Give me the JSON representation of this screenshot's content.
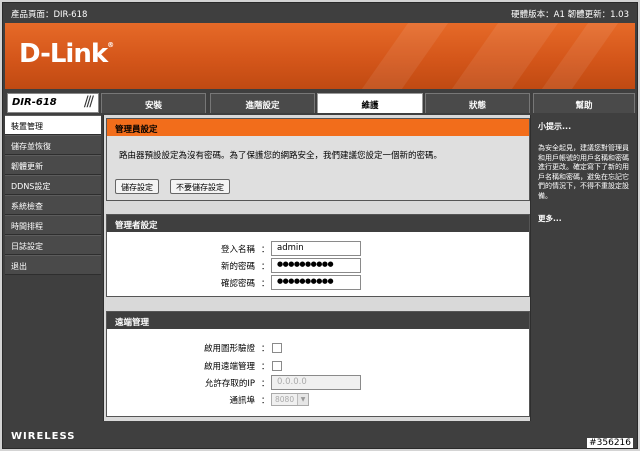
{
  "header": {
    "product_page": "產品頁面：DIR-618",
    "hw_fw_version": "硬體版本：A1   韌體更新：1.03"
  },
  "brand": {
    "logo": "D-Link",
    "model": "DIR-618",
    "footer_logo": "WIRELESS"
  },
  "colors": {
    "accent_orange": "#f26d1b",
    "dark_gray": "#3f3f3f",
    "banner_orange": "#d4561a"
  },
  "tabs": [
    "安裝",
    "進階設定",
    "維護",
    "狀態",
    "幫助"
  ],
  "active_tab": "維護",
  "sidebar": {
    "items": [
      "裝置管理",
      "儲存並恢復",
      "韌體更新",
      "DDNS設定",
      "系統檢查",
      "時間排程",
      "日誌設定",
      "退出"
    ]
  },
  "admin_intro": {
    "title": "管理員設定",
    "message": "路由器預設設定為沒有密碼。為了保護您的網路安全，我們建議您設定一個新的密碼。",
    "save_button": "儲存設定",
    "dont_save_button": "不要儲存設定"
  },
  "admin_settings": {
    "title": "管理者設定",
    "username_label": "登入名稱",
    "username_value": "admin",
    "new_password_label": "新的密碼",
    "new_password_value": "●●●●●●●●●●",
    "confirm_password_label": "確認密碼",
    "confirm_password_value": "●●●●●●●●●●",
    "colon": "："
  },
  "remote_mgmt": {
    "title": "遠端管理",
    "graphic_auth_label": "啟用圖形驗證",
    "remote_admin_label": "啟用遠端管理",
    "allowed_ip_label": "允許存取的IP",
    "allowed_ip_placeholder": "0.0.0.0",
    "port_label": "通訊埠",
    "port_value": "8080",
    "colon": "："
  },
  "help": {
    "title": "小提示...",
    "body": "為安全起見，建議您對管理員和用戶帳號的用戶名稱和密碼進行更改。確定寫下了新的用戶名稱和密碼，避免在忘記它們的情況下，不得不重設定設備。",
    "more": "更多..."
  },
  "image_id": "#356216"
}
